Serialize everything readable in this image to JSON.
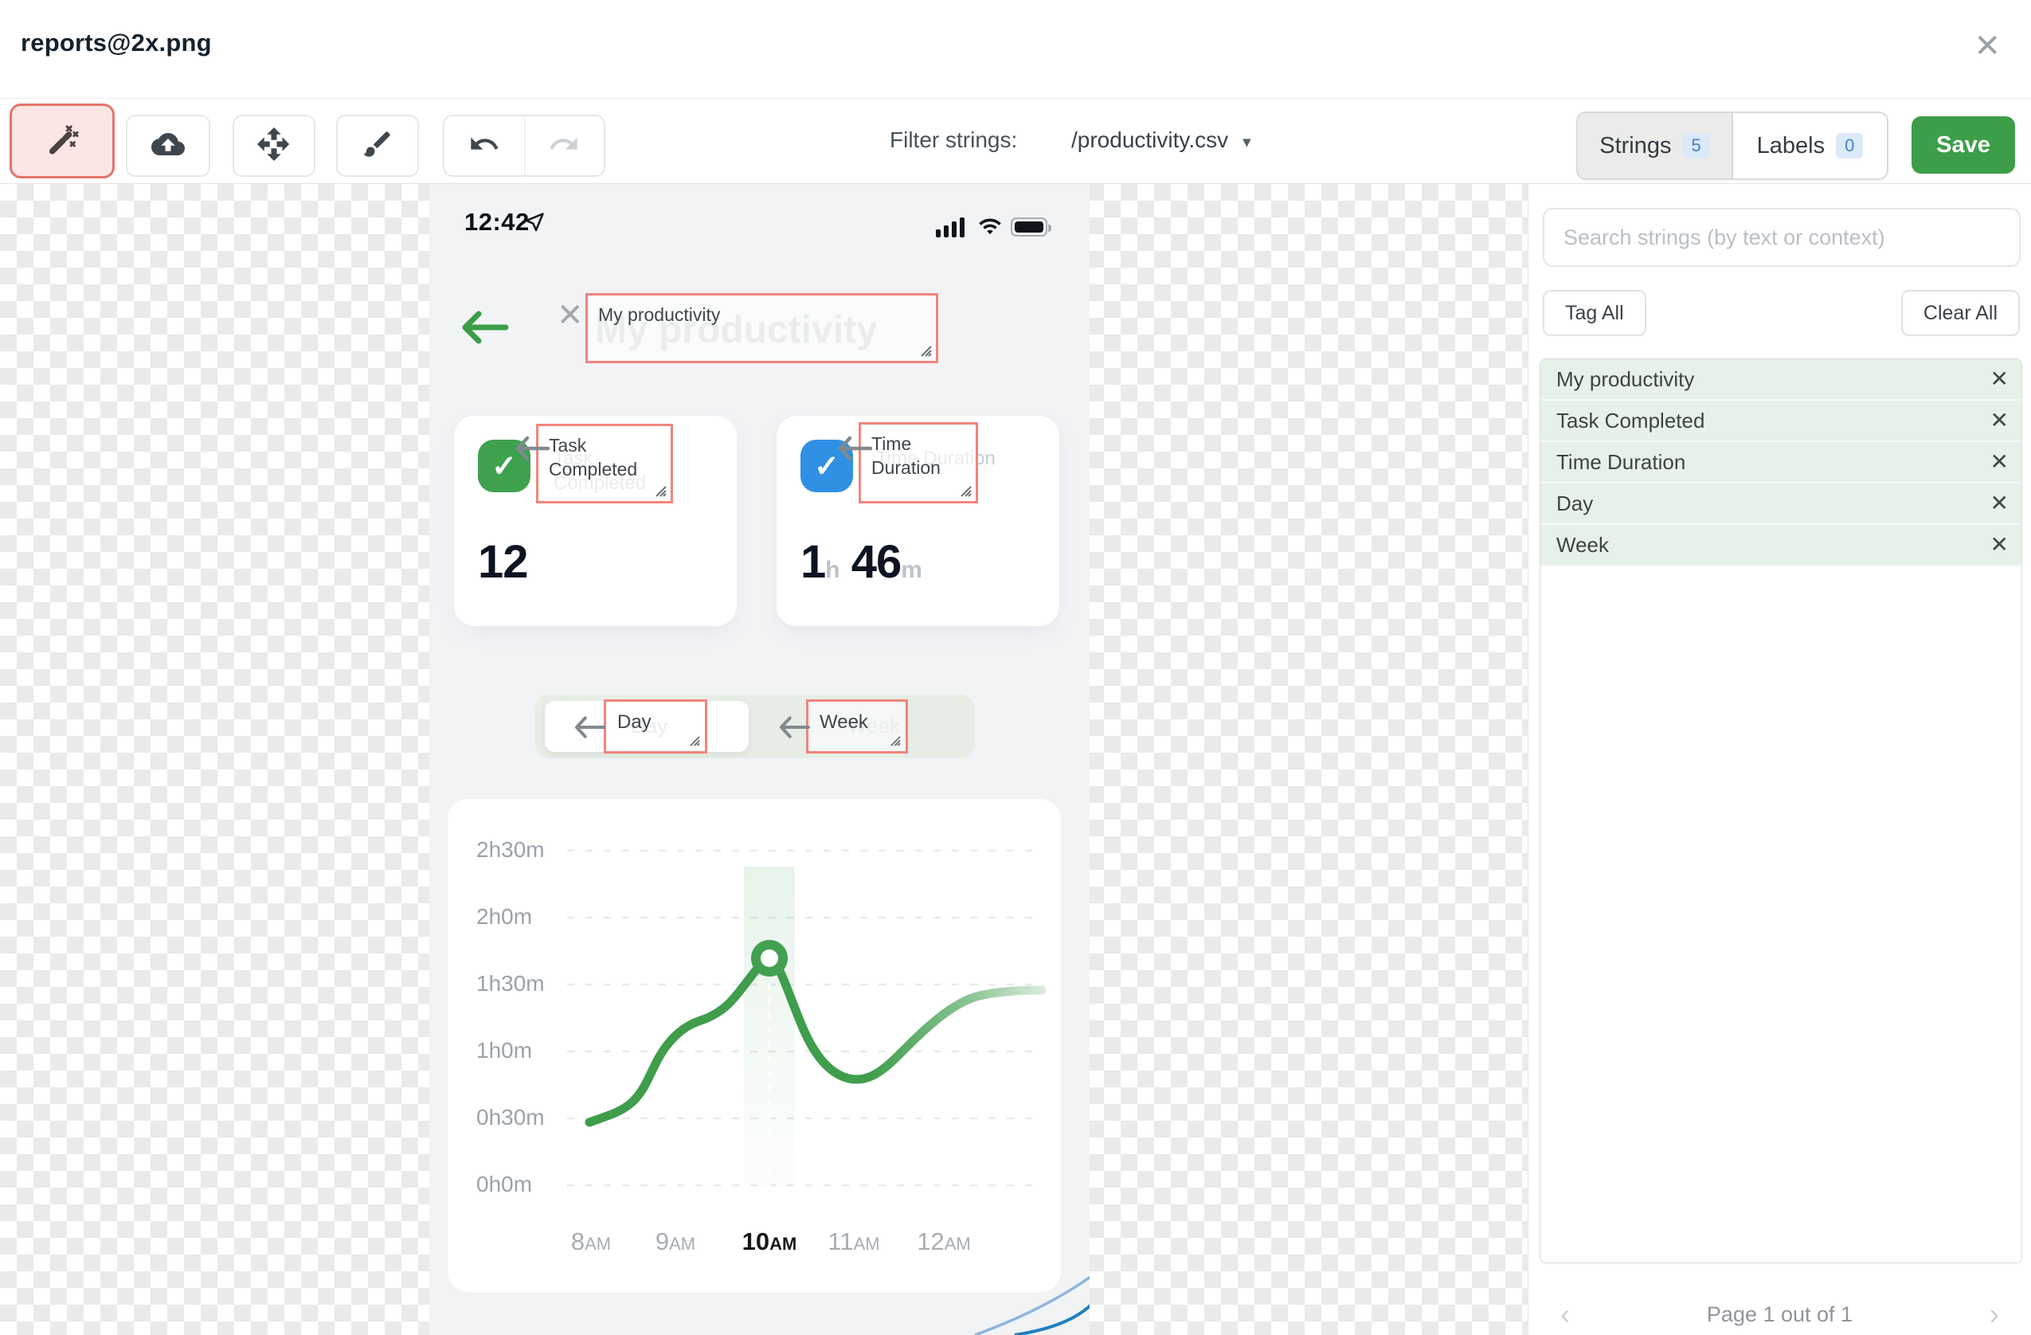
{
  "window": {
    "title": "reports@2x.png"
  },
  "icons": {
    "close": "✕",
    "caret_down": "▾",
    "chevron_left": "‹",
    "chevron_right": "›",
    "check": "✓"
  },
  "toolbar": {
    "filter_label": "Filter strings:",
    "filter_value": "/productivity.csv",
    "strings_tab": "Strings",
    "strings_count": "5",
    "labels_tab": "Labels",
    "labels_count": "0",
    "save_label": "Save"
  },
  "sidebar": {
    "search_placeholder": "Search strings (by text or context)",
    "tag_all": "Tag All",
    "clear_all": "Clear All",
    "strings": [
      "My productivity",
      "Task Completed",
      "Time Duration",
      "Day",
      "Week"
    ],
    "pagination": "Page 1 out of 1"
  },
  "phone": {
    "status_time": "12:42",
    "header_title": "My productivity",
    "task_card": {
      "label": "Task Completed",
      "value": "12"
    },
    "time_card": {
      "label": "Time Duration",
      "hours": "1",
      "hours_unit": "h",
      "minutes": "46",
      "minutes_unit": "m"
    },
    "toggle": {
      "day": "Day",
      "week": "Week"
    }
  },
  "chart_data": {
    "type": "line",
    "title": "",
    "xlabel": "",
    "ylabel": "",
    "x": [
      "8AM",
      "9AM",
      "10AM",
      "11AM",
      "12AM"
    ],
    "xticks": [
      {
        "n": "8",
        "s": "AM"
      },
      {
        "n": "9",
        "s": "AM"
      },
      {
        "n": "10",
        "s": "AM"
      },
      {
        "n": "11",
        "s": "AM"
      },
      {
        "n": "12",
        "s": "AM"
      }
    ],
    "yticks": [
      "2h30m",
      "2h0m",
      "1h30m",
      "1h0m",
      "0h30m",
      "0h0m"
    ],
    "ylim_hours": [
      0,
      2.5
    ],
    "grid": "dashed-horizontal",
    "legend": "none",
    "series": [
      {
        "name": "Time Duration",
        "values_hours": [
          0.47,
          1.25,
          1.72,
          0.82,
          1.4
        ],
        "values_labels": [
          "0h28m",
          "1h15m",
          "1h43m",
          "0h49m",
          "1h24m"
        ]
      }
    ],
    "highlight": {
      "x": "10AM",
      "marker": true,
      "marker_value_hours": 1.72
    },
    "line_color": "#3f9d4c"
  },
  "colors": {
    "save_green": "#3d9e49",
    "tag_border_red": "#f2847c",
    "task_icon_green": "#3da14e",
    "time_icon_blue": "#2f90e4",
    "badge_blue": "#4083c9",
    "string_row_green": "#e6f1e7"
  }
}
